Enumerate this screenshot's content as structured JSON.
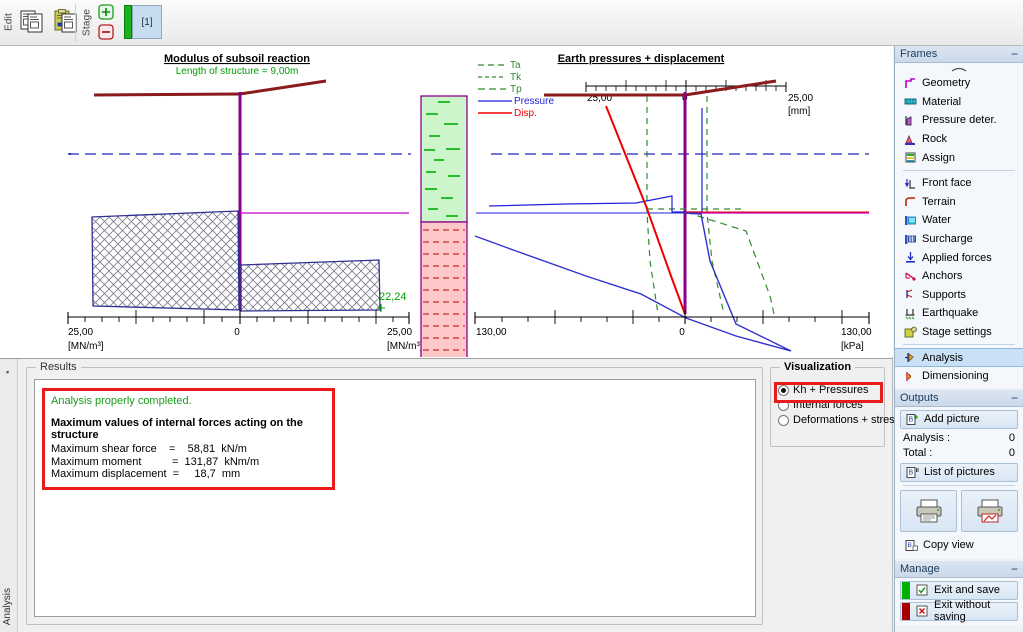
{
  "toolbar": {
    "edit_label": "Edit",
    "stage_label": "Stage",
    "copy_icon": "copy-icon",
    "paste_icon": "paste-icon",
    "add_stage_icon": "plus-circle-icon",
    "remove_stage_icon": "minus-circle-icon",
    "stage_tab_label": "[1]"
  },
  "left_rail": {
    "settings_icon": "gear-icon"
  },
  "bottom_rail": {
    "tab_label": "Analysis",
    "pin_icon": "pin-icon"
  },
  "results": {
    "group_title": "Results",
    "status": "Analysis properly completed.",
    "heading": "Maximum values of internal forces acting on the structure",
    "lines": [
      "Maximum shear force    =    58,81  kN/m",
      "Maximum moment          =  131,87  kNm/m",
      "Maximum displacement  =     18,7  mm"
    ]
  },
  "visualization": {
    "title": "Visualization",
    "options": [
      {
        "label": "Kh + Pressures",
        "selected": true
      },
      {
        "label": "Internal forces",
        "selected": false
      },
      {
        "label": "Deformations + stresses",
        "selected": false
      }
    ]
  },
  "sidebar": {
    "frames": {
      "title": "Frames",
      "minimize_icon": "minimize-icon",
      "collapse_icon": "chevron-up-icon",
      "group_a": [
        {
          "label": "Geometry",
          "icon": "geometry-icon"
        },
        {
          "label": "Material",
          "icon": "material-icon"
        },
        {
          "label": "Pressure deter.",
          "icon": "pressure-icon"
        },
        {
          "label": "Rock",
          "icon": "rock-icon"
        },
        {
          "label": "Assign",
          "icon": "assign-icon"
        }
      ],
      "group_b": [
        {
          "label": "Front face",
          "icon": "front-face-icon"
        },
        {
          "label": "Terrain",
          "icon": "terrain-icon"
        },
        {
          "label": "Water",
          "icon": "water-icon"
        },
        {
          "label": "Surcharge",
          "icon": "surcharge-icon"
        },
        {
          "label": "Applied forces",
          "icon": "applied-forces-icon"
        },
        {
          "label": "Anchors",
          "icon": "anchors-icon"
        },
        {
          "label": "Supports",
          "icon": "supports-icon"
        },
        {
          "label": "Earthquake",
          "icon": "earthquake-icon"
        },
        {
          "label": "Stage settings",
          "icon": "stage-settings-icon"
        }
      ],
      "group_c": [
        {
          "label": "Analysis",
          "icon": "analysis-icon",
          "active": true
        },
        {
          "label": "Dimensioning",
          "icon": "dimensioning-icon",
          "active": false
        }
      ]
    },
    "outputs": {
      "title": "Outputs",
      "minimize_icon": "minimize-icon",
      "add_picture": "Add picture",
      "add_picture_icon": "add-picture-icon",
      "analysis_label": "Analysis :",
      "analysis_value": "0",
      "total_label": "Total :",
      "total_value": "0",
      "list_of_pictures": "List of pictures",
      "list_icon": "list-pictures-icon",
      "print_icon": "printer-icon",
      "print_preview_icon": "printer-preview-icon",
      "copy_view": "Copy view",
      "copy_view_icon": "copy-view-icon"
    },
    "manage": {
      "title": "Manage",
      "minimize_icon": "minimize-icon",
      "exit_save": "Exit and save",
      "exit_save_icon": "check-box-icon",
      "exit_save_color": "#00b000",
      "exit_nosave": "Exit without saving",
      "exit_nosave_icon": "cross-box-icon",
      "exit_nosave_color": "#a80000"
    }
  },
  "chart_data": [
    {
      "id": "modulus-chart",
      "type": "area",
      "title": "Modulus of subsoil reaction",
      "subtitle": "Length of structure = 9,00m",
      "xlabel": "[MN/m³]",
      "axis_left_label": "25,00",
      "axis_center_label": "0",
      "axis_right_label": "25,00",
      "unit_left": "[MN/m³]",
      "unit_right": "[MN/m³]",
      "xlim": [
        -25.0,
        25.0
      ],
      "annotation": "22,24",
      "annotation_color": "#00a000",
      "colors": {
        "structure": "#8b1a1a",
        "wall": "#8b008b",
        "hatch_outline": "#303090",
        "water_line": "#2020c0",
        "soil_line": "#c000c0"
      },
      "left_block": {
        "top_value": -21.5,
        "bottom_value": -22.0,
        "y_from": 0.0,
        "y_to": 0.0
      },
      "right_block": {
        "top_value": 22.24,
        "bottom_value": 21.8
      },
      "soil_profile": [
        {
          "name": "layer-1",
          "color": "#ccf5cc",
          "border": "#8b008b",
          "dash_color": "#00a000",
          "fraction": 0.58
        },
        {
          "name": "layer-2",
          "color": "#ffc8c8",
          "border": "#8b008b",
          "dash_color": "#c00000",
          "fraction": 0.42
        }
      ]
    },
    {
      "id": "pressures-chart",
      "type": "line",
      "title": "Earth pressures + displacement",
      "xlabel": "[kPa]",
      "top_axis_left_label": "25,00",
      "top_axis_center_label": "0",
      "top_axis_right_label": "25,00",
      "top_unit": "[mm]",
      "bottom_axis_left_label": "130,00",
      "bottom_axis_center_label": "0",
      "bottom_axis_right_label": "130,00",
      "bottom_unit": "[kPa]",
      "xlim": [
        -130.0,
        130.0
      ],
      "top_xlim": [
        -25.0,
        25.0
      ],
      "legend": [
        {
          "label": "Ta",
          "color": "#2e8b2e",
          "style": "dashed"
        },
        {
          "label": "Tk",
          "color": "#2e8b2e",
          "style": "dashed"
        },
        {
          "label": "Tp",
          "color": "#2e8b2e",
          "style": "dashed"
        },
        {
          "label": "Pressure",
          "color": "#2020dd",
          "style": "solid"
        },
        {
          "label": "Disp.",
          "color": "#ee0000",
          "style": "solid"
        }
      ],
      "series": [
        {
          "name": "Ta",
          "color": "#2e8b2e",
          "style": "dashed"
        },
        {
          "name": "Tk",
          "color": "#2e8b2e",
          "style": "dashed"
        },
        {
          "name": "Tp",
          "color": "#2e8b2e",
          "style": "dashed"
        },
        {
          "name": "Pressure",
          "color": "#2020dd",
          "style": "solid"
        },
        {
          "name": "Disp.",
          "color": "#ee0000",
          "style": "solid"
        }
      ]
    }
  ]
}
